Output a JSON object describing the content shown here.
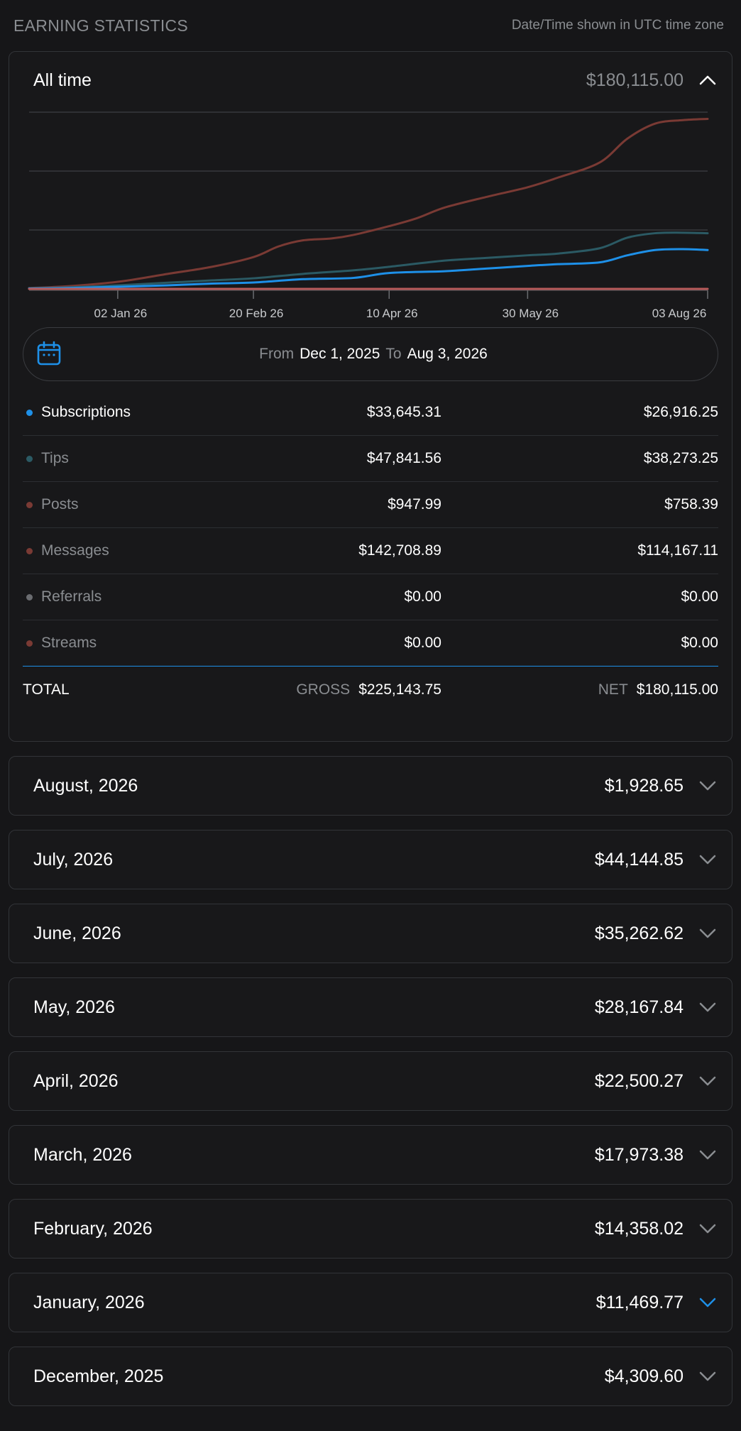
{
  "header": {
    "title": "EARNING STATISTICS",
    "timezone_note": "Date/Time shown in UTC time zone"
  },
  "summary": {
    "label": "All time",
    "amount": "$180,115.00",
    "chevron": "chevron-up-icon"
  },
  "chart_data": {
    "type": "line",
    "x_tick_labels": [
      "02 Jan 26",
      "20 Feb 26",
      "10 Apr 26",
      "30 May 26",
      "03 Aug 26"
    ],
    "x_dates": [
      "2025-12-01",
      "2026-01-02",
      "2026-02-20",
      "2026-04-10",
      "2026-05-30",
      "2026-08-03"
    ],
    "grid": true,
    "series": [
      {
        "color": "#7a3a34",
        "points": [
          [
            "2025-12-01",
            0.005
          ],
          [
            "2025-12-15",
            0.015
          ],
          [
            "2026-01-02",
            0.04
          ],
          [
            "2026-01-20",
            0.085
          ],
          [
            "2026-02-05",
            0.125
          ],
          [
            "2026-02-20",
            0.18
          ],
          [
            "2026-03-01",
            0.24
          ],
          [
            "2026-03-10",
            0.275
          ],
          [
            "2026-03-20",
            0.285
          ],
          [
            "2026-03-28",
            0.305
          ],
          [
            "2026-04-10",
            0.355
          ],
          [
            "2026-04-20",
            0.4
          ],
          [
            "2026-04-30",
            0.46
          ],
          [
            "2026-05-15",
            0.52
          ],
          [
            "2026-05-30",
            0.575
          ],
          [
            "2026-06-10",
            0.63
          ],
          [
            "2026-06-25",
            0.715
          ],
          [
            "2026-07-05",
            0.85
          ],
          [
            "2026-07-15",
            0.935
          ],
          [
            "2026-07-25",
            0.955
          ],
          [
            "2026-08-03",
            0.962
          ]
        ]
      },
      {
        "color": "#2b5a64",
        "points": [
          [
            "2025-12-01",
            0.004
          ],
          [
            "2025-12-15",
            0.008
          ],
          [
            "2026-01-02",
            0.02
          ],
          [
            "2026-01-20",
            0.035
          ],
          [
            "2026-02-05",
            0.048
          ],
          [
            "2026-02-20",
            0.06
          ],
          [
            "2026-03-10",
            0.085
          ],
          [
            "2026-03-28",
            0.105
          ],
          [
            "2026-04-10",
            0.125
          ],
          [
            "2026-04-30",
            0.16
          ],
          [
            "2026-05-15",
            0.175
          ],
          [
            "2026-05-30",
            0.19
          ],
          [
            "2026-06-10",
            0.2
          ],
          [
            "2026-06-25",
            0.23
          ],
          [
            "2026-07-05",
            0.29
          ],
          [
            "2026-07-15",
            0.315
          ],
          [
            "2026-07-25",
            0.318
          ],
          [
            "2026-08-03",
            0.315
          ]
        ]
      },
      {
        "color": "#1e90e8",
        "points": [
          [
            "2025-12-01",
            0.002
          ],
          [
            "2025-12-15",
            0.005
          ],
          [
            "2026-01-02",
            0.012
          ],
          [
            "2026-01-20",
            0.02
          ],
          [
            "2026-02-05",
            0.03
          ],
          [
            "2026-02-20",
            0.036
          ],
          [
            "2026-03-10",
            0.055
          ],
          [
            "2026-03-28",
            0.062
          ],
          [
            "2026-04-10",
            0.09
          ],
          [
            "2026-04-30",
            0.1
          ],
          [
            "2026-05-15",
            0.115
          ],
          [
            "2026-05-30",
            0.13
          ],
          [
            "2026-06-10",
            0.14
          ],
          [
            "2026-06-25",
            0.15
          ],
          [
            "2026-07-05",
            0.19
          ],
          [
            "2026-07-15",
            0.22
          ],
          [
            "2026-07-25",
            0.225
          ],
          [
            "2026-08-03",
            0.22
          ]
        ]
      },
      {
        "color": "#b85a5a",
        "points": [
          [
            "2025-12-01",
            0.0
          ],
          [
            "2026-08-03",
            0.0
          ]
        ]
      }
    ]
  },
  "date_range": {
    "from_label": "From",
    "from_value": "Dec 1, 2025",
    "to_label": "To",
    "to_value": "Aug 3, 2026",
    "icon": "calendar-icon"
  },
  "breakdown": [
    {
      "name": "Subscriptions",
      "gross": "$33,645.31",
      "net": "$26,916.25",
      "dot": "#1e90e8",
      "active": true
    },
    {
      "name": "Tips",
      "gross": "$47,841.56",
      "net": "$38,273.25",
      "dot": "#2b5a64",
      "active": false
    },
    {
      "name": "Posts",
      "gross": "$947.99",
      "net": "$758.39",
      "dot": "#7a3a34",
      "active": false
    },
    {
      "name": "Messages",
      "gross": "$142,708.89",
      "net": "$114,167.11",
      "dot": "#7a3a34",
      "active": false
    },
    {
      "name": "Referrals",
      "gross": "$0.00",
      "net": "$0.00",
      "dot": "#6a6c70",
      "active": false
    },
    {
      "name": "Streams",
      "gross": "$0.00",
      "net": "$0.00",
      "dot": "#7a3a34",
      "active": false
    }
  ],
  "total": {
    "label": "TOTAL",
    "gross_label": "GROSS",
    "gross": "$225,143.75",
    "net_label": "NET",
    "net": "$180,115.00"
  },
  "months": [
    {
      "label": "August, 2026",
      "amount": "$1,928.65",
      "chevron_color": "#8a8d91"
    },
    {
      "label": "July, 2026",
      "amount": "$44,144.85",
      "chevron_color": "#8a8d91"
    },
    {
      "label": "June, 2026",
      "amount": "$35,262.62",
      "chevron_color": "#8a8d91"
    },
    {
      "label": "May, 2026",
      "amount": "$28,167.84",
      "chevron_color": "#8a8d91"
    },
    {
      "label": "April, 2026",
      "amount": "$22,500.27",
      "chevron_color": "#8a8d91"
    },
    {
      "label": "March, 2026",
      "amount": "$17,973.38",
      "chevron_color": "#8a8d91"
    },
    {
      "label": "February, 2026",
      "amount": "$14,358.02",
      "chevron_color": "#8a8d91"
    },
    {
      "label": "January, 2026",
      "amount": "$11,469.77",
      "chevron_color": "#1e90e8"
    },
    {
      "label": "December, 2025",
      "amount": "$4,309.60",
      "chevron_color": "#8a8d91"
    }
  ]
}
